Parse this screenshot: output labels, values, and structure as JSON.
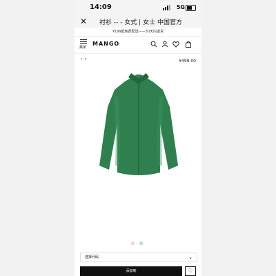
{
  "status_bar": {
    "time": "14:09",
    "network": "5G"
  },
  "title_bar": {
    "close_icon": "close-icon",
    "title": "衬衫 -- - 女式 | 女士 中国官方"
  },
  "promo": {
    "text": "¥199起免费配送——30天内退货"
  },
  "header": {
    "menu_label": "菜单",
    "logo": "MANGO",
    "icons": [
      "search-icon",
      "user-icon",
      "heart-icon",
      "bag-icon"
    ]
  },
  "product": {
    "price": "¥499.00",
    "image_description": "green satin shirt",
    "colors": [
      "#f1d7df",
      "#bfe3cf"
    ]
  },
  "size_select": {
    "label": "选择尺码"
  },
  "cart_button": {
    "label": "添加到"
  }
}
